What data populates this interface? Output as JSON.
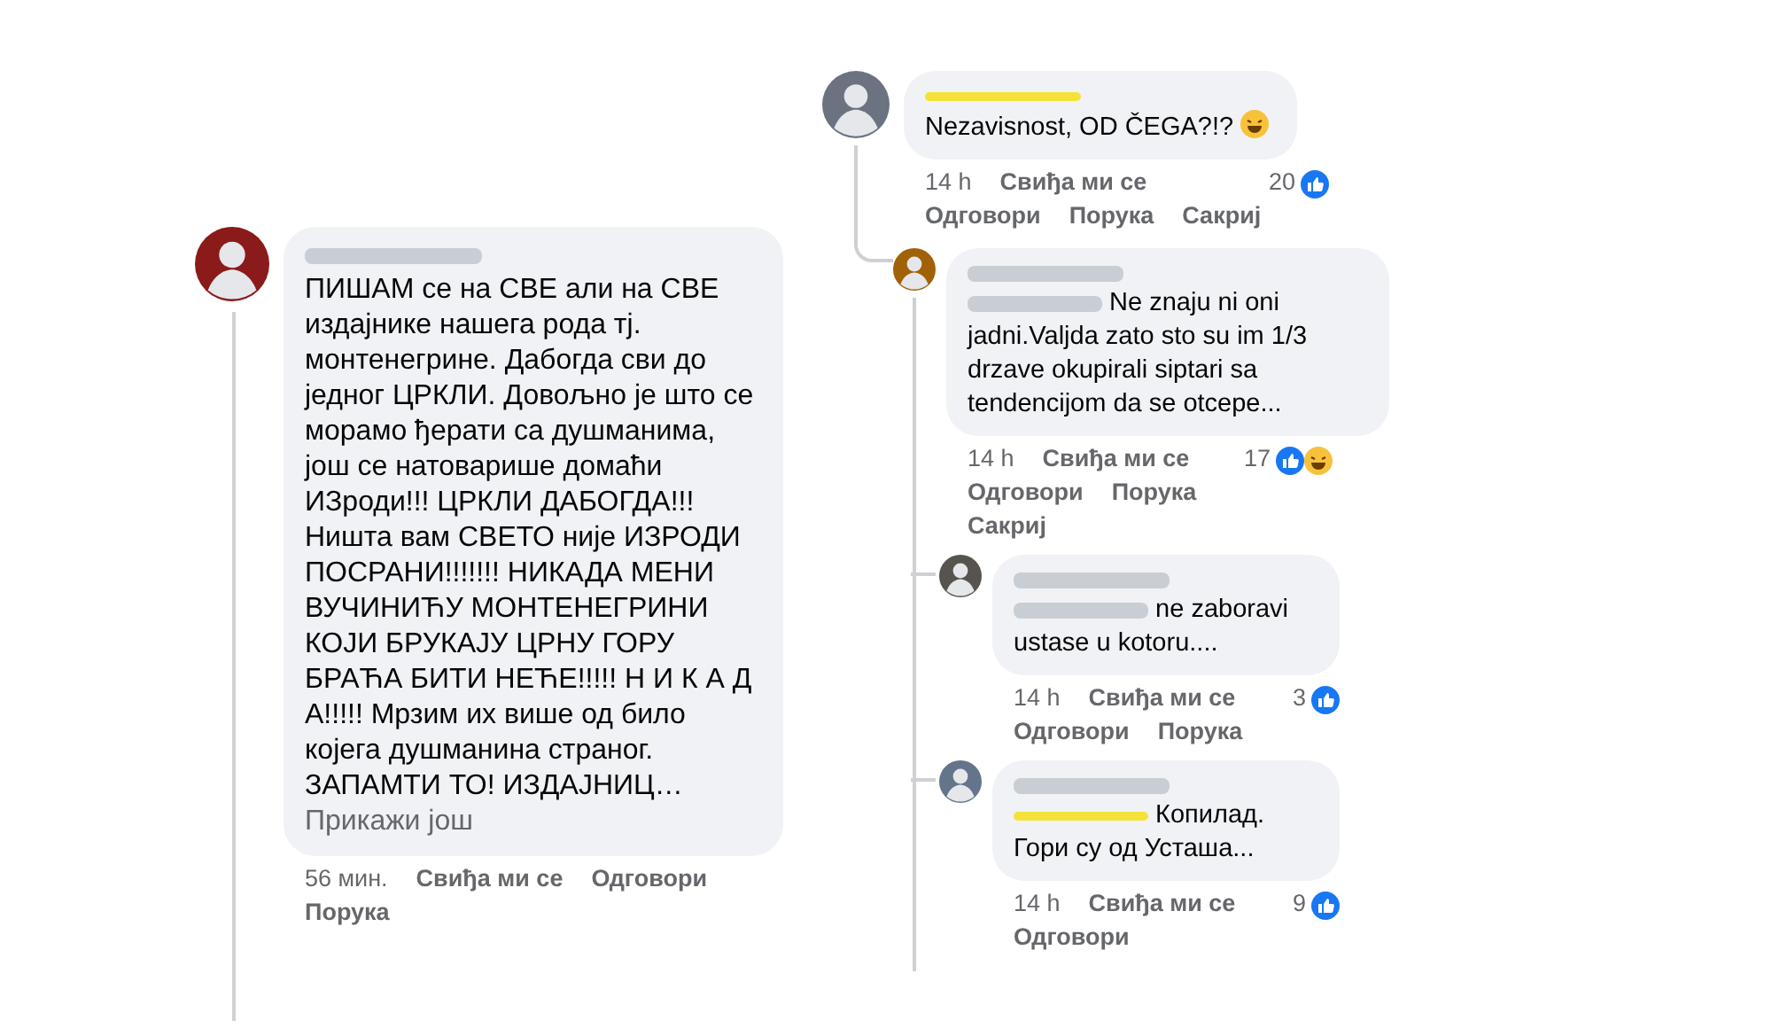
{
  "comments": [
    {
      "name_highlighted": false,
      "text": "ПИШАМ се на СВЕ али на СВЕ издајнике нашега рода тј. монтенегрине. Дабогда сви до једног ЦРКЛИ. Довољно је што се морамо ђерати са душманима, још се натоварише домаћи ИЗроди!!! ЦРКЛИ ДАБОГДА!!! Ништа вам СВЕТО није ИЗРОДИ ПОСРАНИ!!!!!!! НИКАДА МЕНИ ВУЧИНИЋУ МОНТЕНЕГРИНИ КОЈИ БРУКАЈУ ЦРНУ ГОРУ БРАЋА БИТИ НЕЋЕ!!!!! Н И К А Д А!!!!! Мрзим их више од било којега душманина страног. ЗАПАМТИ ТО! ИЗДАЈНИЦ…",
      "more": "Прикажи још",
      "footer_rows": [
        [
          {
            "kind": "time",
            "text": "56 мин."
          },
          {
            "kind": "action",
            "text": "Свиђа ми се"
          },
          {
            "kind": "action",
            "text": "Одговори"
          }
        ],
        [
          {
            "kind": "action",
            "text": "Порука"
          }
        ]
      ]
    },
    {
      "name_highlighted": true,
      "text": "Nezavisnost, OD ČEGA?!?",
      "laugh_emoji": true,
      "reactions": {
        "count": "20",
        "like": true,
        "laugh": false
      },
      "footer_rows": [
        [
          {
            "kind": "time",
            "text": "14 h"
          },
          {
            "kind": "action",
            "text": "Свиђа ми се"
          }
        ],
        [
          {
            "kind": "action",
            "text": "Одговори"
          },
          {
            "kind": "action",
            "text": "Порука"
          },
          {
            "kind": "action",
            "text": "Сакриј"
          }
        ]
      ],
      "replies": [
        {
          "name_highlighted": false,
          "mention": {
            "highlighted": false
          },
          "text": "Ne znaju ni oni jadni.Valjda zato sto su im 1/3 drzave okupirali siptari sa tendencijom da se otcepe...",
          "reactions": {
            "count": "17",
            "like": true,
            "laugh": true
          },
          "footer_rows": [
            [
              {
                "kind": "time",
                "text": "14 h"
              },
              {
                "kind": "action",
                "text": "Свиђа ми се"
              }
            ],
            [
              {
                "kind": "action",
                "text": "Одговори"
              },
              {
                "kind": "action",
                "text": "Порука"
              }
            ],
            [
              {
                "kind": "action",
                "text": "Сакриј"
              }
            ]
          ],
          "replies": [
            {
              "name_highlighted": false,
              "mention": {
                "highlighted": false
              },
              "text": "ne zaboravi ustase u kotoru....",
              "reactions": {
                "count": "3",
                "like": true,
                "laugh": false
              },
              "footer_rows": [
                [
                  {
                    "kind": "time",
                    "text": "14 h"
                  },
                  {
                    "kind": "action",
                    "text": "Свиђа ми се"
                  }
                ],
                [
                  {
                    "kind": "action",
                    "text": "Одговори"
                  },
                  {
                    "kind": "action",
                    "text": "Порука"
                  }
                ]
              ]
            },
            {
              "name_highlighted": false,
              "mention": {
                "highlighted": true
              },
              "text": "Копилад. Гори су од Усташа...",
              "reactions": {
                "count": "9",
                "like": true,
                "laugh": false
              },
              "footer_rows": [
                [
                  {
                    "kind": "time",
                    "text": "14 h"
                  },
                  {
                    "kind": "action",
                    "text": "Свиђа ми се"
                  }
                ],
                [
                  {
                    "kind": "action",
                    "text": "Одговори"
                  }
                ]
              ]
            }
          ]
        }
      ]
    }
  ]
}
